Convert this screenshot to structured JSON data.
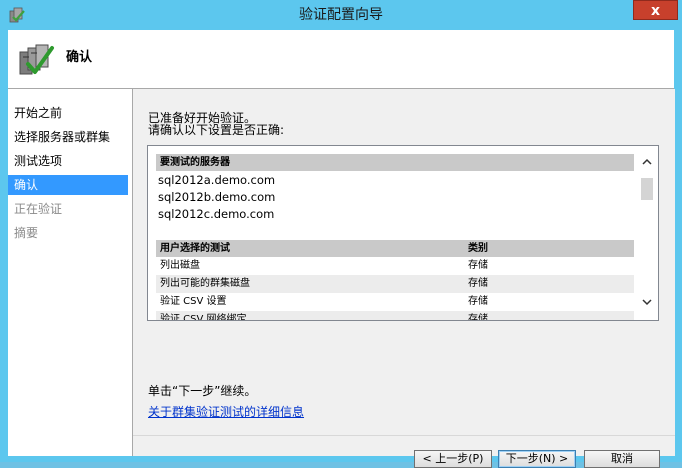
{
  "window": {
    "title": "验证配置向导",
    "close_label": "x"
  },
  "header": {
    "title": "确认"
  },
  "nav": {
    "items": [
      {
        "label": "开始之前",
        "state": "normal"
      },
      {
        "label": "选择服务器或群集",
        "state": "normal"
      },
      {
        "label": "测试选项",
        "state": "normal"
      },
      {
        "label": "确认",
        "state": "active"
      },
      {
        "label": "正在验证",
        "state": "disabled"
      },
      {
        "label": "摘要",
        "state": "disabled"
      }
    ]
  },
  "main": {
    "intro_line1": "已准备好开始验证。",
    "intro_line2": "请确认以下设置是否正确:",
    "servers_header": "要测试的服务器",
    "servers": [
      "sql2012a.demo.com",
      "sql2012b.demo.com",
      "sql2012c.demo.com"
    ],
    "tests_header_name": "用户选择的测试",
    "tests_header_category": "类别",
    "tests": [
      {
        "name": "列出磁盘",
        "category": "存储"
      },
      {
        "name": "列出可能的群集磁盘",
        "category": "存储"
      },
      {
        "name": "验证 CSV 设置",
        "category": "存储"
      },
      {
        "name": "验证 CSV 网络绑定",
        "category": "存储"
      }
    ],
    "hint": "单击“下一步”继续。",
    "link": "关于群集验证测试的详细信息"
  },
  "buttons": {
    "back": "< 上一步(P)",
    "next": "下一步(N) >",
    "cancel": "取消"
  },
  "colors": {
    "titlebar": "#5cc7ee",
    "close": "#c7402c",
    "nav_active": "#3399ff",
    "link": "#0033cc"
  }
}
